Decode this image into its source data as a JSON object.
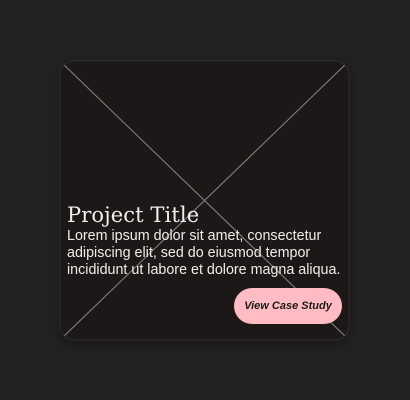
{
  "card": {
    "title": "Project Title",
    "description": "Lorem ipsum dolor sit amet, consectetur adipiscing elit, sed do eiusmod tempor incididunt ut labore et dolore magna aliqua.",
    "button_label": "View Case Study",
    "image_icon": "image-placeholder-icon"
  },
  "colors": {
    "background": "#222222",
    "card": "#1c1817",
    "accent": "#ffbcc2",
    "text": "#f0ecea"
  }
}
